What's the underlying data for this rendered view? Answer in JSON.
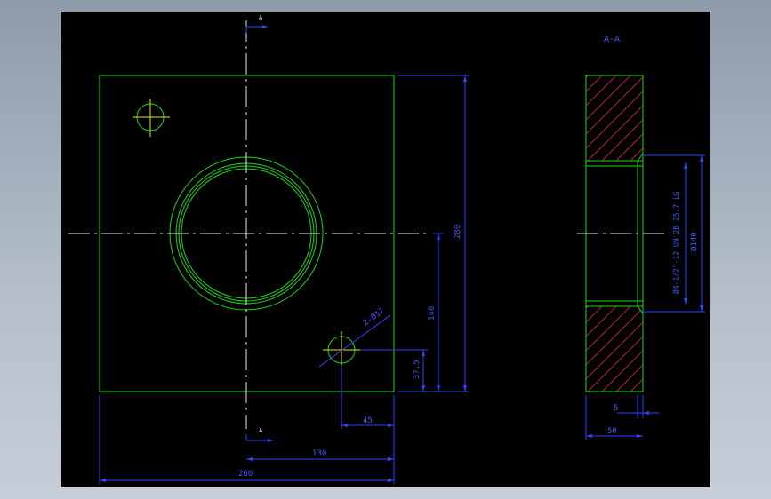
{
  "drawing": {
    "section_title": "A-A",
    "section_marks": [
      "A",
      "A"
    ],
    "dimensions": {
      "height": "280",
      "hole_height": "140",
      "small_hole_height": "37.5",
      "small_hole_offset": "45",
      "center_offset": "130",
      "width": "260",
      "depth": "5",
      "thickness": "50",
      "hole_callout": "2-Ø17",
      "bore_diameter": "Ø140",
      "thread_callout": "Ø4-1/2\"-12 UN 2B  25.7 LG"
    }
  },
  "colors": {
    "background": "#000000",
    "outline": "#19d619",
    "dimension": "#2e45ff",
    "centerline": "#e8e8e8",
    "hatch": "#d62b2b"
  }
}
